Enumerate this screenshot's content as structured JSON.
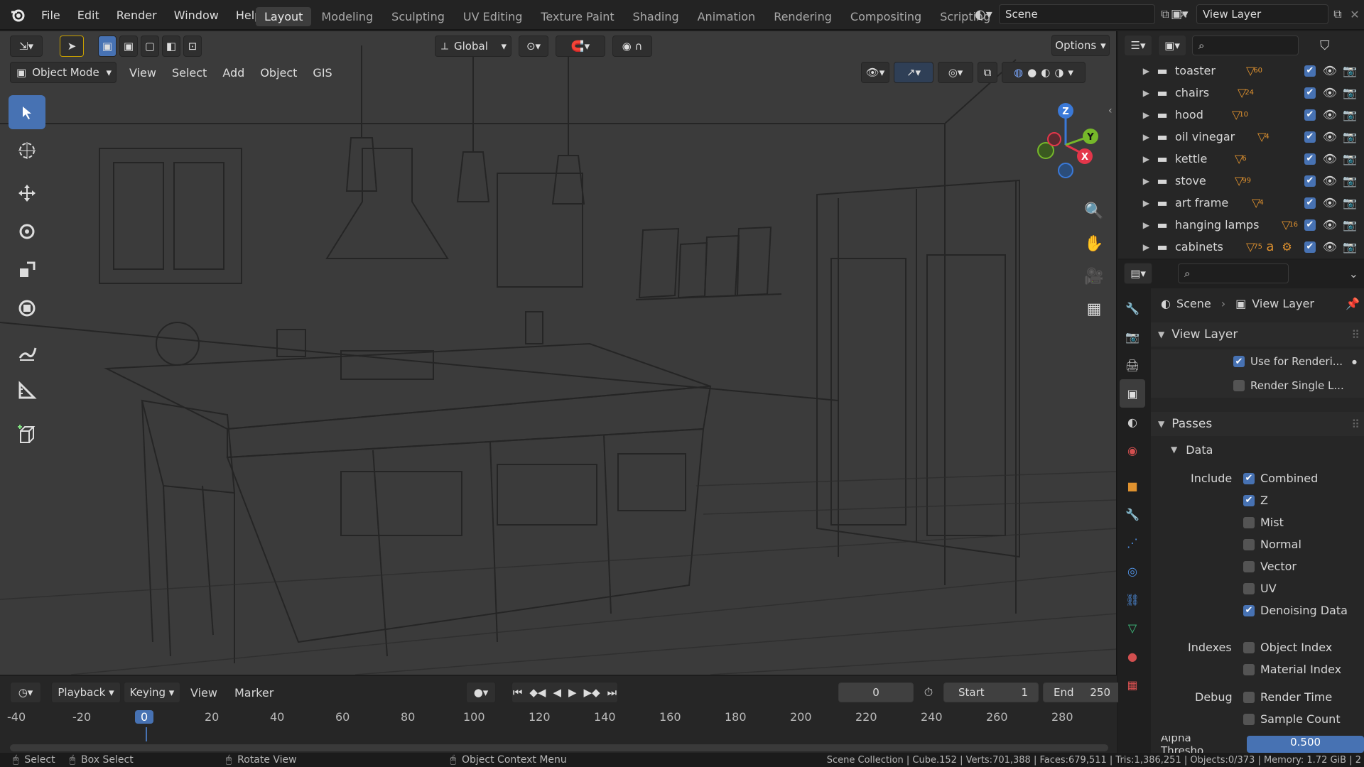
{
  "topbar": {
    "menu": [
      "File",
      "Edit",
      "Render",
      "Window",
      "Help"
    ],
    "workspaces": [
      "Layout",
      "Modeling",
      "Sculpting",
      "UV Editing",
      "Texture Paint",
      "Shading",
      "Animation",
      "Rendering",
      "Compositing",
      "Scripting"
    ],
    "add_workspace": "+",
    "scene_label": "Scene",
    "view_layer_label": "View Layer"
  },
  "viewport": {
    "orientation": "Global",
    "options_label": "Options",
    "mode": "Object Mode",
    "menus": [
      "View",
      "Select",
      "Add",
      "Object",
      "GIS"
    ],
    "gizmo": {
      "x": "X",
      "y": "Y",
      "z": "Z"
    }
  },
  "tools": [
    "select-box-icon",
    "cursor-icon",
    "move-icon",
    "rotate-icon",
    "scale-icon",
    "transform-icon",
    "annotate-icon",
    "measure-icon",
    "add-cube-icon"
  ],
  "timeline": {
    "menus": [
      "Playback",
      "Keying",
      "View",
      "Marker"
    ],
    "current_frame": "0",
    "start_label": "Start",
    "start_value": "1",
    "end_label": "End",
    "end_value": "250",
    "ruler": [
      "-40",
      "-20",
      "0",
      "20",
      "40",
      "60",
      "80",
      "100",
      "120",
      "140",
      "160",
      "180",
      "200",
      "220",
      "240",
      "260",
      "280"
    ]
  },
  "outliner": {
    "items": [
      {
        "name": "toaster",
        "badge": "60"
      },
      {
        "name": "chairs",
        "badge": "24"
      },
      {
        "name": "hood",
        "badge": "10"
      },
      {
        "name": "oil vinegar",
        "badge": "4"
      },
      {
        "name": "kettle",
        "badge": "6"
      },
      {
        "name": "stove",
        "badge": "99"
      },
      {
        "name": "art frame",
        "badge": "4"
      },
      {
        "name": "hanging lamps",
        "badge": "16"
      },
      {
        "name": "cabinets",
        "badge": "75"
      }
    ]
  },
  "properties": {
    "breadcrumb_scene": "Scene",
    "breadcrumb_layer": "View Layer",
    "panel_view_layer": "View Layer",
    "use_for_rendering": "Use for Renderi...",
    "render_single_layer": "Render Single L...",
    "panel_passes": "Passes",
    "sub_data": "Data",
    "include_label": "Include",
    "passes": [
      {
        "label": "Combined",
        "checked": true
      },
      {
        "label": "Z",
        "checked": true
      },
      {
        "label": "Mist",
        "checked": false
      },
      {
        "label": "Normal",
        "checked": false
      },
      {
        "label": "Vector",
        "checked": false
      },
      {
        "label": "UV",
        "checked": false
      },
      {
        "label": "Denoising Data",
        "checked": true
      }
    ],
    "indexes_label": "Indexes",
    "indexes": [
      {
        "label": "Object Index",
        "checked": false
      },
      {
        "label": "Material Index",
        "checked": false
      }
    ],
    "debug_label": "Debug",
    "debug": [
      {
        "label": "Render Time",
        "checked": false
      },
      {
        "label": "Sample Count",
        "checked": false
      }
    ],
    "alpha_label": "Alpha Thresho...",
    "alpha_value": "0.500"
  },
  "statusbar": {
    "select": "Select",
    "box_select": "Box Select",
    "rotate_view": "Rotate View",
    "context_menu": "Object Context Menu",
    "stats": "Scene Collection | Cube.152 | Verts:701,388 | Faces:679,511 | Tris:1,386,251 | Objects:0/373 | Memory: 1.72 GiB | 2"
  }
}
